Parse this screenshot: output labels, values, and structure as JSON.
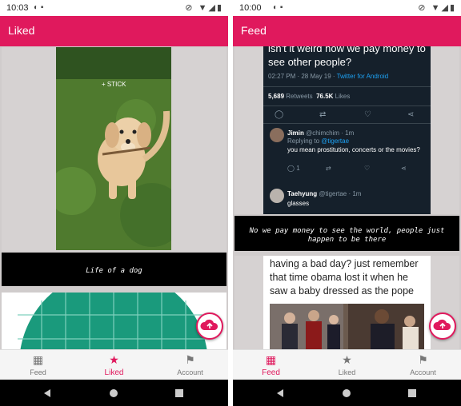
{
  "left": {
    "status": {
      "time": "10:03"
    },
    "appbar": {
      "title": "Liked"
    },
    "post1": {
      "overlay_text": "+ STICK",
      "caption": "Life of a dog"
    },
    "nav": {
      "items": [
        {
          "label": "Feed"
        },
        {
          "label": "Liked"
        },
        {
          "label": "Account"
        }
      ],
      "active": "Liked"
    }
  },
  "right": {
    "status": {
      "time": "10:00"
    },
    "appbar": {
      "title": "Feed"
    },
    "tweet": {
      "text": "isn't it weird how we pay money to see other people?",
      "meta": "02:27 PM · 28 May 19 · ",
      "meta_link": "Twitter for Android",
      "retweets_count": "5,689",
      "retweets_label": "Retweets",
      "likes_count": "76.5K",
      "likes_label": "Likes",
      "reply1": {
        "name": "Jimin",
        "handle": "@chimchim · 1m",
        "replying_label": "Replying to ",
        "replying_to": "@tigertae",
        "text": "you mean prostitution, concerts or the movies?",
        "reply_count": "1"
      },
      "reply2": {
        "name": "Taehyung",
        "handle": "@tigertae · 1m",
        "text": "glasses"
      }
    },
    "post1_caption": "No we pay money to see the world, people just happen to be there",
    "meme": {
      "text": "having a bad day? just remember that time obama lost it when he saw a baby dressed as the pope"
    },
    "nav": {
      "items": [
        {
          "label": "Feed"
        },
        {
          "label": "Liked"
        },
        {
          "label": "Account"
        }
      ],
      "active": "Feed"
    }
  },
  "colors": {
    "accent": "#e0195d",
    "tweet_bg": "#15202b",
    "link": "#1da1f2"
  },
  "icons": [
    "wifi-icon",
    "signal-icon",
    "battery-icon",
    "upload-cloud-icon",
    "feed-grid-icon",
    "star-icon",
    "account-icon",
    "back-icon",
    "home-icon",
    "recents-icon"
  ]
}
